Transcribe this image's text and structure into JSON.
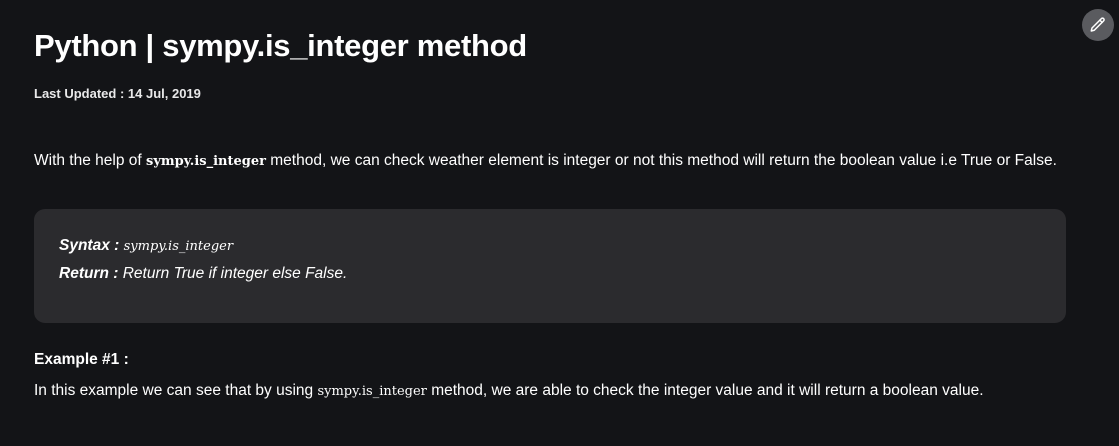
{
  "article": {
    "title": "Python | sympy.is_integer method",
    "last_updated": "Last Updated : 14 Jul, 2019",
    "intro": {
      "before": "With the help of ",
      "code": "sympy.is_integer",
      "after": " method, we can check weather element is integer or not this method will return the boolean value i.e True or False."
    },
    "syntax_box": {
      "syntax_label": "Syntax :",
      "syntax_value": "sympy.is_integer",
      "return_label": "Return :",
      "return_value": "Return True if integer else False."
    },
    "example": {
      "heading": "Example #1 :",
      "before": "In this example we can see that by using ",
      "code": "sympy.is_integer",
      "after": " method, we are able to check the integer value and it will return a boolean value."
    }
  },
  "toolbar": {
    "edit_icon": "pencil-icon"
  },
  "colors": {
    "background": "#131417",
    "syntax_box": "#2b2b2e",
    "edit_button": "#5a5b5f",
    "text": "#ffffff"
  }
}
